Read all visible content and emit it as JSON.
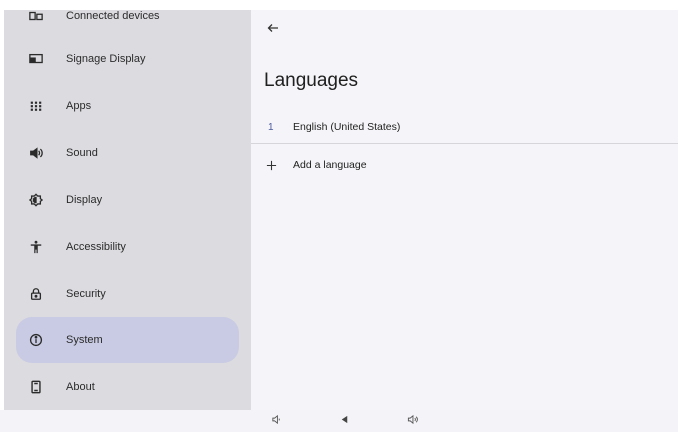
{
  "sidebar": {
    "items": [
      {
        "label": "Connected devices",
        "icon": "connected-devices-icon"
      },
      {
        "label": "Signage Display",
        "icon": "signage-display-icon"
      },
      {
        "label": "Apps",
        "icon": "apps-grid-icon"
      },
      {
        "label": "Sound",
        "icon": "speaker-icon"
      },
      {
        "label": "Display",
        "icon": "brightness-icon"
      },
      {
        "label": "Accessibility",
        "icon": "accessibility-icon"
      },
      {
        "label": "Security",
        "icon": "lock-icon"
      },
      {
        "label": "System",
        "icon": "info-icon",
        "active": true
      },
      {
        "label": "About",
        "icon": "device-icon"
      }
    ]
  },
  "content": {
    "back_icon": "arrow-back-icon",
    "title": "Languages",
    "languages": [
      {
        "index": "1",
        "name": "English (United States)"
      }
    ],
    "add_label": "Add a language"
  },
  "navbar": {
    "buttons": [
      "volume-down-icon",
      "back-triangle-icon",
      "volume-up-icon"
    ]
  },
  "colors": {
    "sidebar_bg": "#dcdbe0",
    "active_item_bg": "#c8cbe3",
    "content_bg": "#f5f4f8",
    "accent": "#4a5a9c"
  }
}
